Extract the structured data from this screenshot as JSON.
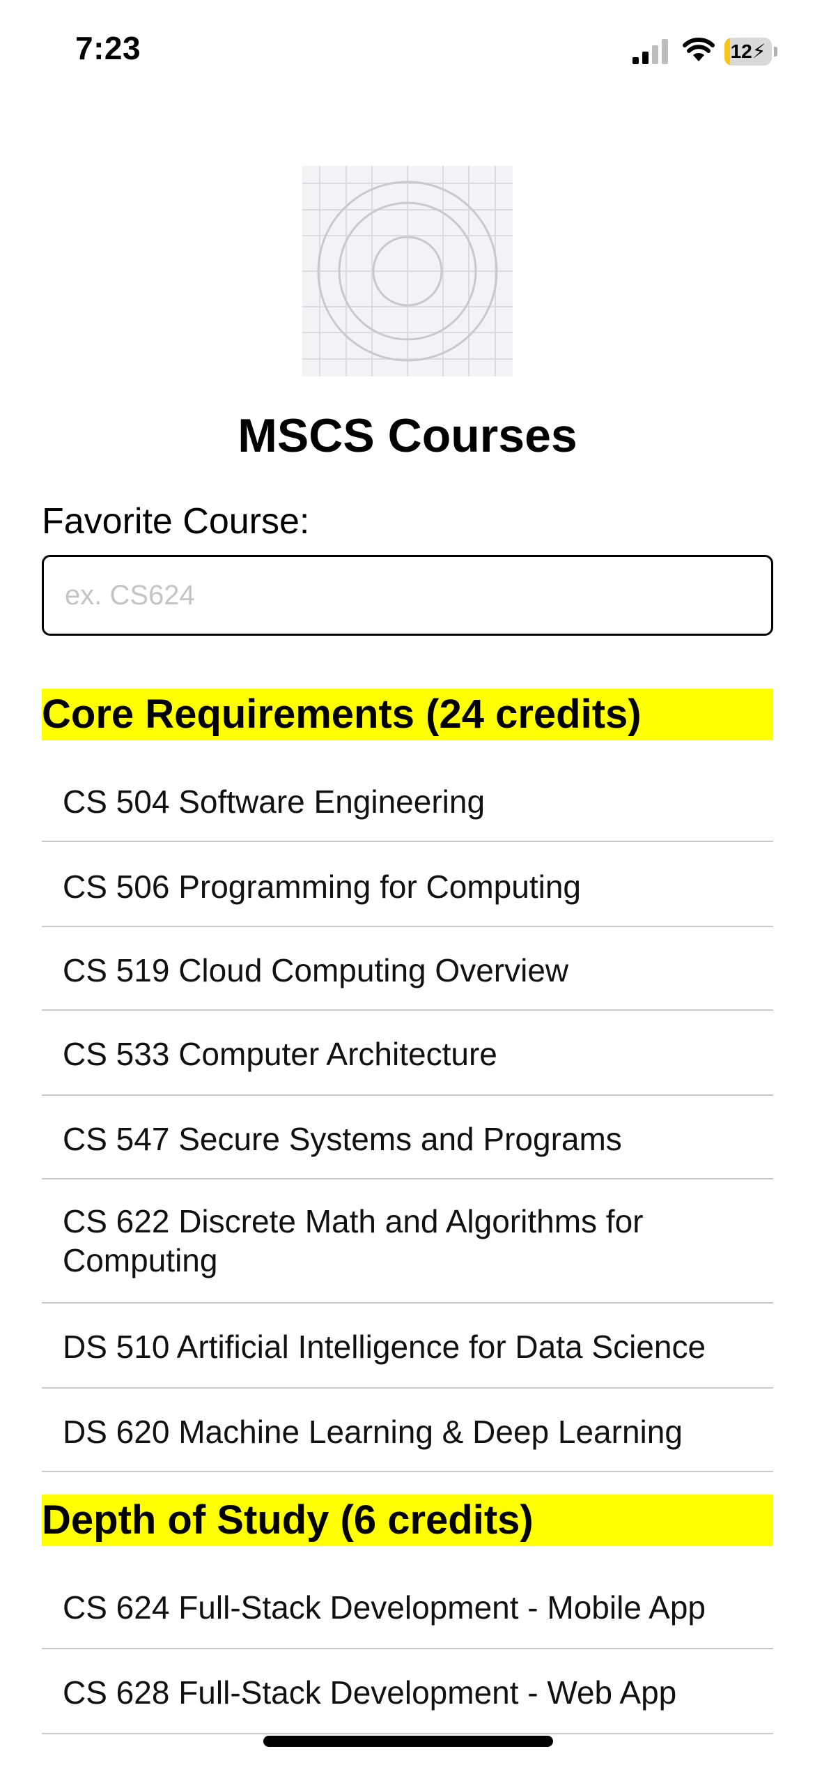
{
  "status_bar": {
    "time": "7:23",
    "battery_level": "12",
    "battery_fraction": 0.12,
    "battery_color": "#f5c518",
    "icons": [
      "cellular-signal-icon",
      "wifi-icon",
      "battery-charging-icon"
    ]
  },
  "logo": {
    "icon": "app-icon-placeholder"
  },
  "page": {
    "title": "MSCS Courses"
  },
  "favorite": {
    "label": "Favorite Course:",
    "placeholder": "ex. CS624",
    "value": ""
  },
  "sections": [
    {
      "title": "Core Requirements (24 credits)",
      "courses": [
        "CS 504 Software Engineering",
        "CS 506 Programming for Computing",
        "CS 519 Cloud Computing Overview",
        "CS 533 Computer Architecture",
        "CS 547 Secure Systems and Programs",
        "CS 622 Discrete Math and Algorithms for Computing",
        "DS 510 Artificial Intelligence for Data Science",
        "DS 620 Machine Learning & Deep Learning"
      ]
    },
    {
      "title": "Depth of Study (6 credits)",
      "courses": [
        "CS 624 Full-Stack Development - Mobile App",
        "CS 628 Full-Stack Development - Web App"
      ]
    }
  ],
  "colors": {
    "section_highlight": "#ffff00",
    "divider": "#c8c8c8",
    "placeholder_text": "#c4c4c4"
  }
}
